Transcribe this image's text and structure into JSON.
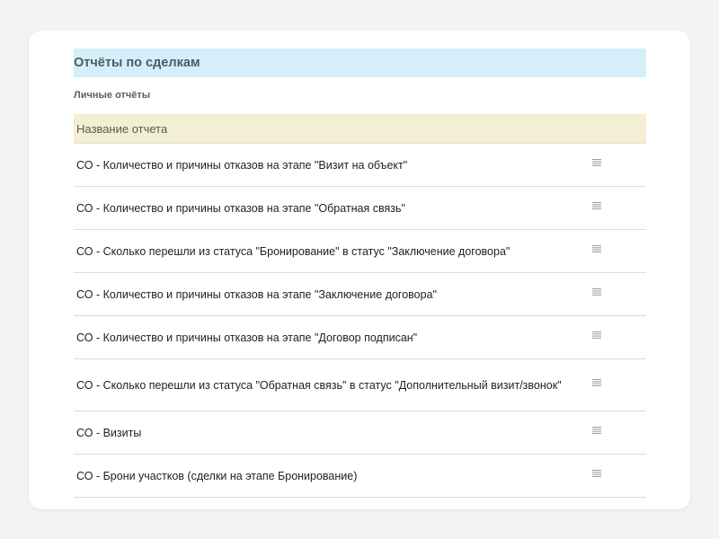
{
  "section": {
    "title": "Отчёты по сделкам",
    "subheading": "Личные отчёты"
  },
  "table": {
    "column_name": "Название отчета",
    "rows": [
      {
        "name": "СО - Количество и причины отказов на этапе \"Визит на объект\"",
        "menu_icon": "menu-lines-icon"
      },
      {
        "name": "СО - Количество и причины отказов на этапе \"Обратная связь\"",
        "menu_icon": "menu-lines-icon"
      },
      {
        "name": "СО - Сколько перешли из статуса \"Бронирование\" в статус \"Заключение договора\"",
        "menu_icon": "menu-lines-icon"
      },
      {
        "name": "СО - Количество и причины отказов на этапе \"Заключение договора\"",
        "menu_icon": "menu-lines-icon"
      },
      {
        "name": "СО - Количество и причины отказов на этапе \"Договор подписан\"",
        "menu_icon": "menu-lines-icon"
      },
      {
        "name": "СО - Сколько перешли из статуса \"Обратная связь\" в статус \"Дополнительный визит/звонок\"",
        "menu_icon": "menu-lines-icon"
      },
      {
        "name": "СО - Визиты",
        "menu_icon": "menu-lines-icon"
      },
      {
        "name": "СО - Брони участков (сделки на этапе Бронирование)",
        "menu_icon": "menu-lines-icon"
      }
    ]
  },
  "colors": {
    "section_header_bg": "#d5eefa",
    "table_header_bg": "#f2efd4",
    "page_bg": "#f3f3f3",
    "card_bg": "#ffffff"
  }
}
